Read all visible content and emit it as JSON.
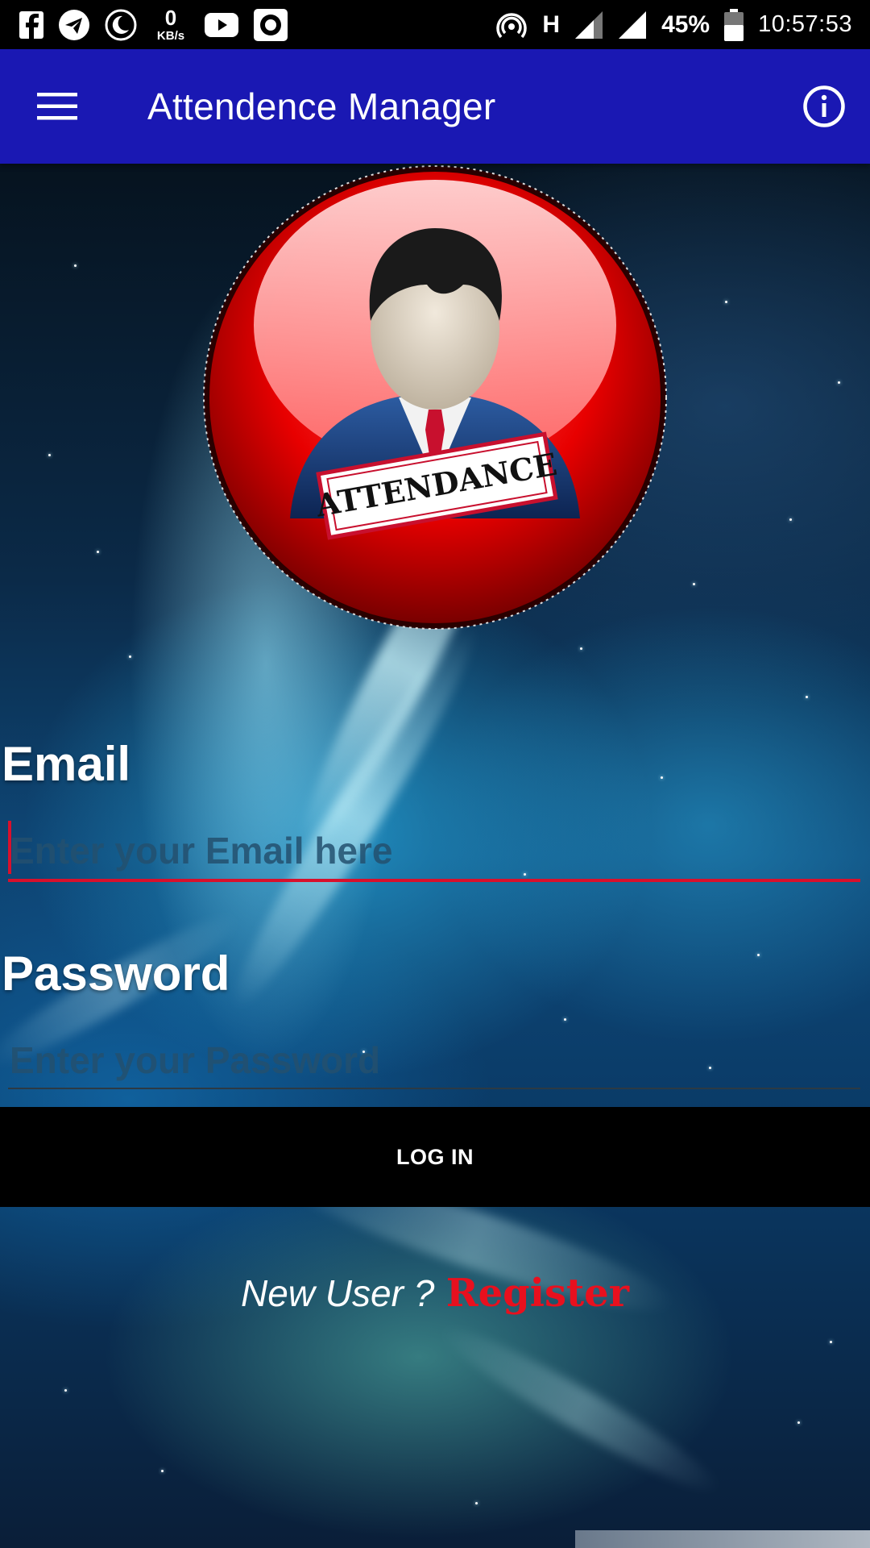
{
  "status_bar": {
    "net_speed_value": "0",
    "net_speed_unit": "KB/s",
    "network_type": "H",
    "battery": "45%",
    "time": "10:57:53",
    "icons": [
      "facebook-icon",
      "telegram-icon",
      "night-mode-icon",
      "youtube-icon",
      "camera-icon",
      "hotspot-icon",
      "signal-icon",
      "signal-icon",
      "battery-icon"
    ]
  },
  "app_bar": {
    "title": "Attendence Manager",
    "background": "#1a18b3",
    "menu_icon": "menu-icon",
    "info_icon": "info-icon"
  },
  "logo": {
    "stamp_text": "ATTENDANCE"
  },
  "form": {
    "email_label": "Email",
    "email_placeholder": "Enter your Email here",
    "email_value": "",
    "email_accent": "#d8102c",
    "password_label": "Password",
    "password_placeholder": "Enter your Password",
    "password_value": "",
    "login_label": "LOG IN"
  },
  "register": {
    "prompt": "New User ?",
    "link": "Register",
    "link_color": "#e8101e"
  }
}
